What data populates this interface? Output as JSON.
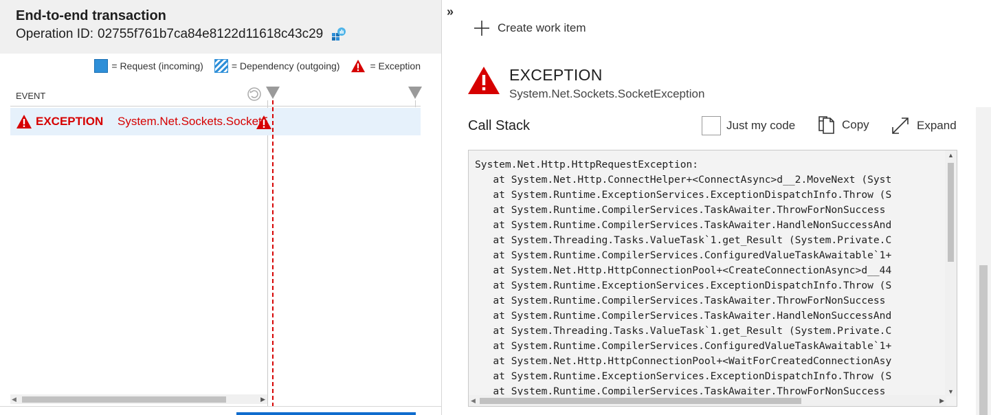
{
  "header": {
    "title": "End-to-end transaction",
    "operation_label": "Operation ID:",
    "operation_id": "02755f761b7ca84e8122d11618c43c29",
    "operation_icon": "app-insights-icon"
  },
  "legend": {
    "request": "= Request (incoming)",
    "dependency": "= Dependency (outgoing)",
    "exception": "= Exception"
  },
  "timeline": {
    "column_header": "EVENT",
    "rows": [
      {
        "type": "EXCEPTION",
        "name": "System.Net.Sockets.SocketException",
        "icon": "warning-triangle-icon"
      }
    ]
  },
  "details": {
    "collapse_glyph": "»",
    "create_work_item": "Create work item",
    "kind": "EXCEPTION",
    "exception_type": "System.Net.Sockets.SocketException",
    "call_stack_title": "Call Stack",
    "just_my_code": "Just my code",
    "just_my_code_checked": false,
    "copy": "Copy",
    "expand": "Expand",
    "call_stack_lines": [
      "System.Net.Http.HttpRequestException:",
      "   at System.Net.Http.ConnectHelper+<ConnectAsync>d__2.MoveNext (Syst",
      "   at System.Runtime.ExceptionServices.ExceptionDispatchInfo.Throw (S",
      "   at System.Runtime.CompilerServices.TaskAwaiter.ThrowForNonSuccess",
      "   at System.Runtime.CompilerServices.TaskAwaiter.HandleNonSuccessAnd",
      "   at System.Threading.Tasks.ValueTask`1.get_Result (System.Private.C",
      "   at System.Runtime.CompilerServices.ConfiguredValueTaskAwaitable`1+",
      "   at System.Net.Http.HttpConnectionPool+<CreateConnectionAsync>d__44",
      "   at System.Runtime.ExceptionServices.ExceptionDispatchInfo.Throw (S",
      "   at System.Runtime.CompilerServices.TaskAwaiter.ThrowForNonSuccess",
      "   at System.Runtime.CompilerServices.TaskAwaiter.HandleNonSuccessAnd",
      "   at System.Threading.Tasks.ValueTask`1.get_Result (System.Private.C",
      "   at System.Runtime.CompilerServices.ConfiguredValueTaskAwaitable`1+",
      "   at System.Net.Http.HttpConnectionPool+<WaitForCreatedConnectionAsy",
      "   at System.Runtime.ExceptionServices.ExceptionDispatchInfo.Throw (S",
      "   at System.Runtime.CompilerServices.TaskAwaiter.ThrowForNonSuccess"
    ]
  },
  "colors": {
    "error_red": "#d60000",
    "request_blue": "#2e8fd8",
    "selected_row": "#e6f1fb",
    "header_bg": "#f0f0f0"
  }
}
